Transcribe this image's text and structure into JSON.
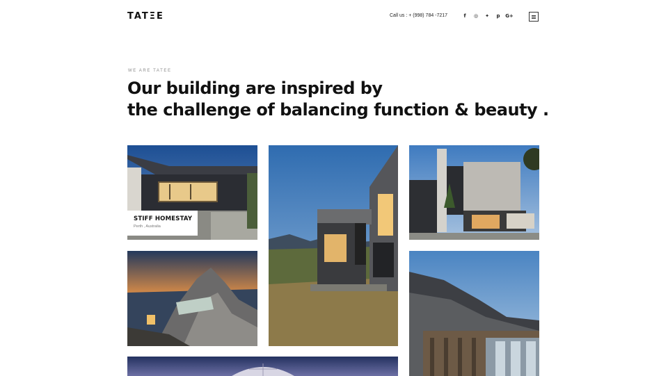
{
  "header": {
    "logo": "TATΞE",
    "call": "Call us : + (998) 784 -7217",
    "socials": [
      {
        "icon": "facebook-icon",
        "glyph": "f"
      },
      {
        "icon": "instagram-icon",
        "glyph": "◎"
      },
      {
        "icon": "twitter-icon",
        "glyph": "✦"
      },
      {
        "icon": "pinterest-icon",
        "glyph": "p"
      },
      {
        "icon": "google-plus-icon",
        "glyph": "G+"
      }
    ],
    "menu_icon": "hamburger-menu-icon"
  },
  "hero": {
    "eyebrow": "WE ARE TATEE",
    "headline_line1": "Our building are inspired by",
    "headline_line2": "the challenge of balancing function & beauty ."
  },
  "projects": [
    {
      "title": "STIFF HOMESTAY",
      "location": "Perth , Australia"
    }
  ]
}
